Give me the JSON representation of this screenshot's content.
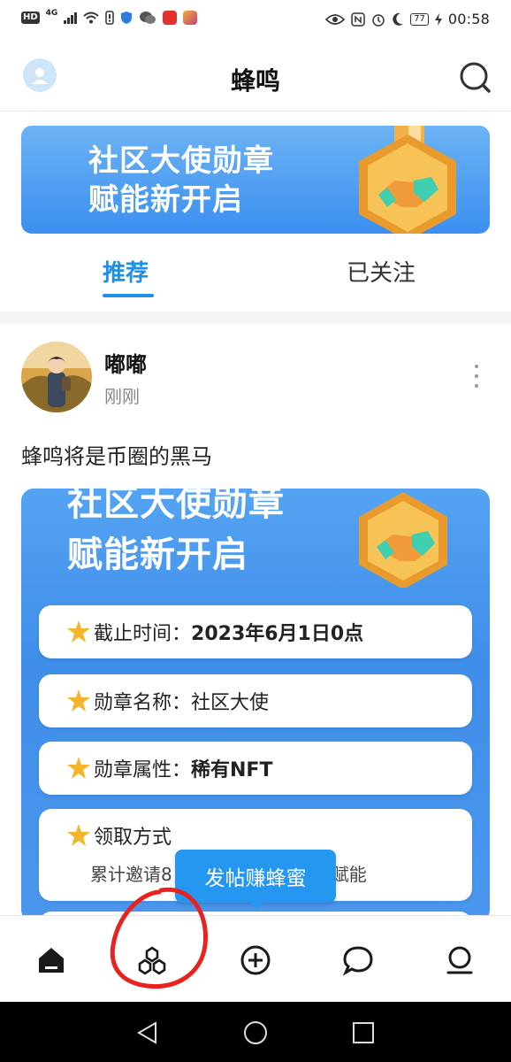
{
  "status_bar": {
    "hd": "HD",
    "network": "4G",
    "battery": "77",
    "time": "00:58"
  },
  "header": {
    "title": "蜂鸣"
  },
  "banner": {
    "line1": "社区大使勋章",
    "line2": "赋能新开启"
  },
  "tabs": {
    "recommend": "推荐",
    "following": "已关注"
  },
  "post": {
    "author": "嘟嘟",
    "time": "刚刚",
    "text": "蜂鸣将是币圈的黑马",
    "image": {
      "title_line1": "社区大使勋章",
      "title_line2": "赋能新开启",
      "rows": [
        {
          "label": "截止时间：",
          "value": "2023年6月1日0点"
        },
        {
          "label": "勋章名称：",
          "value": "社区大使"
        },
        {
          "label": "勋章属性：",
          "value": "稀有NFT"
        }
      ],
      "method_label": "领取方式",
      "method_sub_left": "累计邀请8",
      "method_sub_right": "可获得赋能"
    }
  },
  "tooltip": {
    "text": "发帖赚蜂蜜"
  },
  "colors": {
    "accent": "#1e90e6",
    "banner_top": "#6cb3f5",
    "banner_bottom": "#3b8ff0",
    "annotation": "#e8231f"
  },
  "icons": {
    "nav": [
      "home-icon",
      "community-icon",
      "add-post-icon",
      "messages-icon",
      "profile-icon"
    ],
    "system": [
      "back-icon",
      "home-circle-icon",
      "recents-icon"
    ]
  }
}
